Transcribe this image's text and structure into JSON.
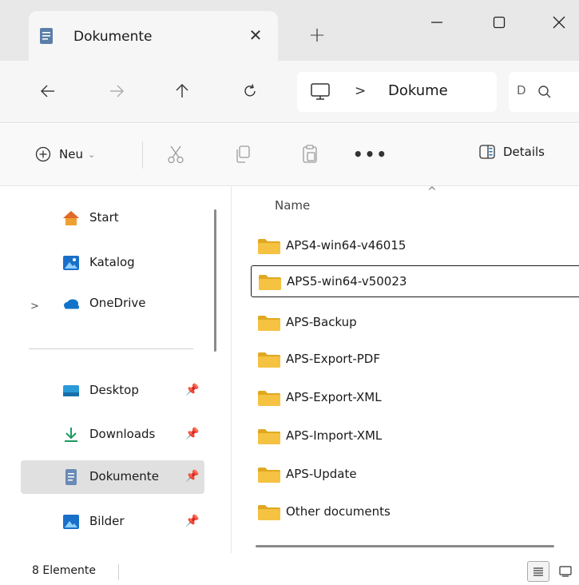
{
  "window": {
    "tab_title": "Dokumente",
    "tab_close_glyph": "✕",
    "new_tab_glyph": "+",
    "minimize_icon": "minimize-icon",
    "maximize_icon": "maximize-icon",
    "close_icon": "close-icon"
  },
  "address_bar": {
    "location_icon": "this-pc-icon",
    "separator": ">",
    "breadcrumb": "Dokume",
    "search_placeholder": "D"
  },
  "command_bar": {
    "new_label": "Neu",
    "new_chevron": "⌄",
    "more_label": "•••",
    "details_label": "Details"
  },
  "navigation": {
    "expander_glyph": ">",
    "pin_glyph": "📌",
    "items": [
      {
        "label": "Start",
        "icon": "home-icon"
      },
      {
        "label": "Katalog",
        "icon": "gallery-icon"
      },
      {
        "label": "OneDrive",
        "icon": "onedrive-icon"
      },
      {
        "label": "Desktop",
        "icon": "desktop-icon"
      },
      {
        "label": "Downloads",
        "icon": "download-icon"
      },
      {
        "label": "Dokumente",
        "icon": "documents-icon"
      },
      {
        "label": "Bilder",
        "icon": "pictures-icon"
      }
    ],
    "selected": "Dokumente"
  },
  "file_list": {
    "sort_glyph": "^",
    "column_name": "Name",
    "focused_item": "APS5-win64-v50023",
    "items": [
      "APS4-win64-v46015",
      "APS5-win64-v50023",
      "APS-Backup",
      "APS-Export-PDF",
      "APS-Export-XML",
      "APS-Import-XML",
      "APS-Update",
      "Other documents"
    ]
  },
  "status_bar": {
    "item_count": "8 Elemente"
  },
  "colors": {
    "folder_yellow": "#f5c242",
    "folder_dark": "#e0a820",
    "onedrive_blue": "#1273c8",
    "selection_gray": "#e0e0e0"
  }
}
